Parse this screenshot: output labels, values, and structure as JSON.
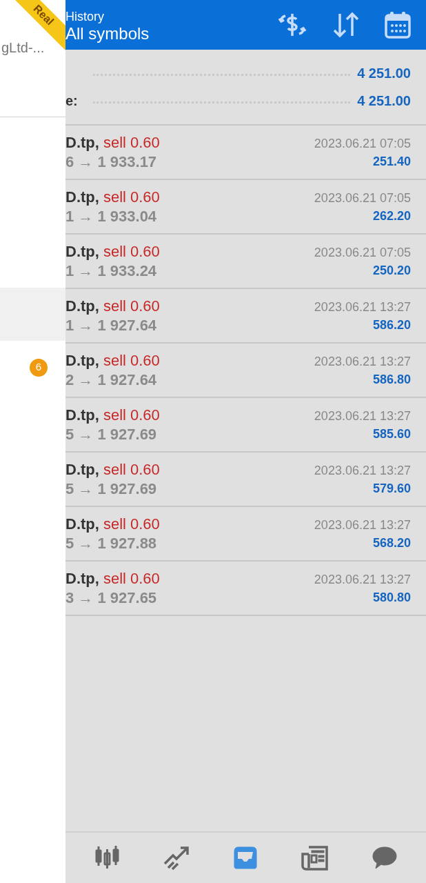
{
  "drawer": {
    "account": "gLtd-...",
    "ribbon": "Real",
    "menu_items": [
      {
        "selected": true
      },
      {
        "selected": false,
        "badge": "6"
      }
    ]
  },
  "header": {
    "title": "History",
    "subtitle": "All symbols"
  },
  "summary": [
    {
      "value": "4 251.00"
    },
    {
      "label": "e:",
      "value": "4 251.00"
    }
  ],
  "deals": [
    {
      "symbol": "D.tp,",
      "trade": "sell 0.60",
      "prices": "6 → 1 933.17",
      "time": "2023.06.21 07:05",
      "profit": "251.40"
    },
    {
      "symbol": "D.tp,",
      "trade": "sell 0.60",
      "prices": "1 → 1 933.04",
      "time": "2023.06.21 07:05",
      "profit": "262.20"
    },
    {
      "symbol": "D.tp,",
      "trade": "sell 0.60",
      "prices": "1 → 1 933.24",
      "time": "2023.06.21 07:05",
      "profit": "250.20"
    },
    {
      "symbol": "D.tp,",
      "trade": "sell 0.60",
      "prices": "1 → 1 927.64",
      "time": "2023.06.21 13:27",
      "profit": "586.20"
    },
    {
      "symbol": "D.tp,",
      "trade": "sell 0.60",
      "prices": "2 → 1 927.64",
      "time": "2023.06.21 13:27",
      "profit": "586.80"
    },
    {
      "symbol": "D.tp,",
      "trade": "sell 0.60",
      "prices": "5 → 1 927.69",
      "time": "2023.06.21 13:27",
      "profit": "585.60"
    },
    {
      "symbol": "D.tp,",
      "trade": "sell 0.60",
      "prices": "5 → 1 927.69",
      "time": "2023.06.21 13:27",
      "profit": "579.60"
    },
    {
      "symbol": "D.tp,",
      "trade": "sell 0.60",
      "prices": "5 → 1 927.88",
      "time": "2023.06.21 13:27",
      "profit": "568.20"
    },
    {
      "symbol": "D.tp,",
      "trade": "sell 0.60",
      "prices": "3 → 1 927.65",
      "time": "2023.06.21 13:27",
      "profit": "580.80"
    }
  ],
  "nav": [
    {
      "kind": "quotes",
      "selected": false
    },
    {
      "kind": "trade",
      "selected": false
    },
    {
      "kind": "history",
      "selected": true
    },
    {
      "kind": "news",
      "selected": false
    },
    {
      "kind": "chat",
      "selected": false
    }
  ]
}
